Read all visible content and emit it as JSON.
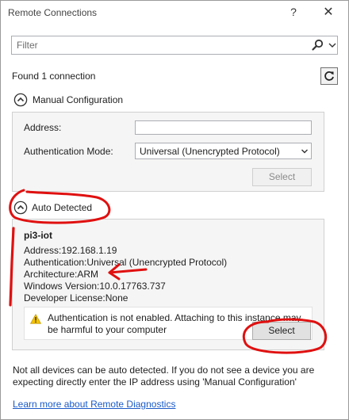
{
  "window": {
    "title": "Remote Connections",
    "help_glyph": "?",
    "close_glyph": "✕"
  },
  "filter": {
    "placeholder": "Filter",
    "value": ""
  },
  "found_text": "Found 1 connection",
  "manual": {
    "header": "Manual Configuration",
    "address_label": "Address:",
    "address_value": "",
    "auth_label": "Authentication Mode:",
    "auth_selected": "Universal (Unencrypted Protocol)",
    "select_label": "Select"
  },
  "auto": {
    "header": "Auto Detected",
    "device": {
      "name": "pi3-iot",
      "address": "Address:192.168.1.19",
      "authentication": "Authentication:Universal (Unencrypted Protocol)",
      "architecture": "Architecture:ARM",
      "windows_version": "Windows Version:10.0.17763.737",
      "developer_license": "Developer License:None"
    },
    "warning": "Authentication is not enabled. Attaching to this instance may be harmful to your computer",
    "select_label": "Select"
  },
  "info_text": "Not all devices can be auto detected. If you do not see a device you are expecting directly enter the IP address using 'Manual Configuration'",
  "learn_more": "Learn more about Remote Diagnostics",
  "colors": {
    "annotation_red": "#e01010",
    "link_blue": "#1a5ac8",
    "warning_yellow": "#f5c400"
  }
}
